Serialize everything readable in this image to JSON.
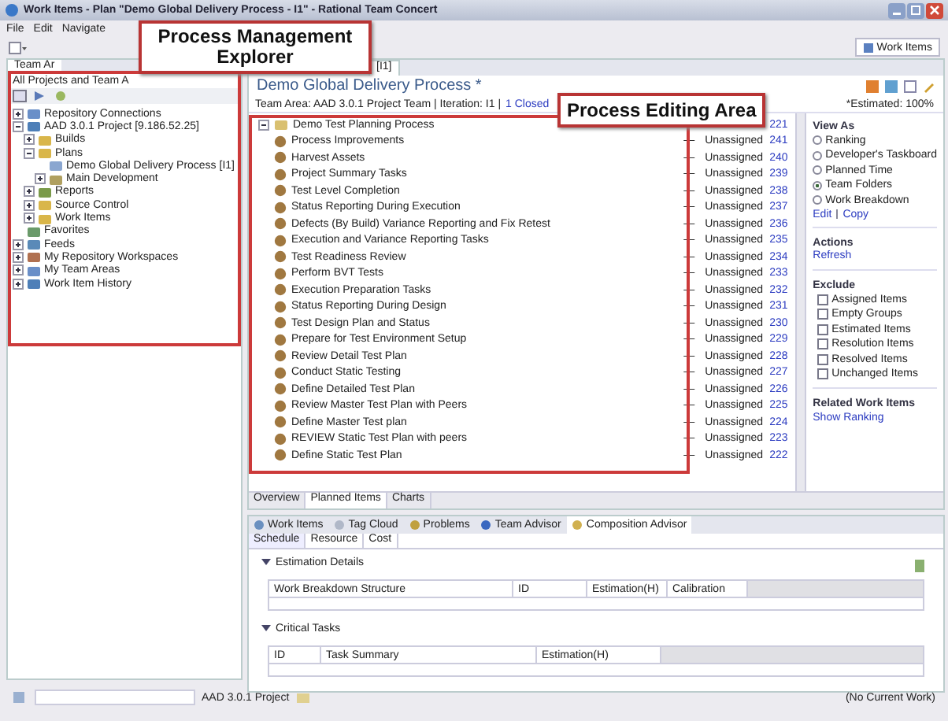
{
  "window": {
    "title": "Work Items - Plan \"Demo Global Delivery Process - I1\" - Rational Team Concert"
  },
  "menu": [
    "File",
    "Edit",
    "Navigate"
  ],
  "perspective": {
    "label": "Work Items"
  },
  "callouts": [
    {
      "text": "Process Management Explorer"
    },
    {
      "text": "Process Editing Area"
    }
  ],
  "explorer": {
    "tab": "Team Ar",
    "filter": "All Projects and Team A",
    "tree": [
      {
        "label": "Repository Connections",
        "expanded": false
      },
      {
        "label": "AAD 3.0.1 Project [9.186.52.25]",
        "expanded": true,
        "children": [
          {
            "label": "Builds",
            "expanded": false
          },
          {
            "label": "Plans",
            "expanded": true,
            "children": [
              {
                "label": "Demo Global Delivery Process [I1]"
              },
              {
                "label": "Main Development",
                "expanded": false
              }
            ]
          },
          {
            "label": "Reports",
            "expanded": false
          },
          {
            "label": "Source Control",
            "expanded": false
          },
          {
            "label": "Work Items",
            "expanded": false
          }
        ]
      },
      {
        "label": "Favorites"
      },
      {
        "label": "Feeds",
        "expanded": false
      },
      {
        "label": "My Repository Workspaces",
        "expanded": false
      },
      {
        "label": "My Team Areas",
        "expanded": false
      },
      {
        "label": "Work Item History",
        "expanded": false
      }
    ]
  },
  "editor": {
    "tab": "[I1]",
    "title": "Demo Global Delivery Process *",
    "team_line": "Team Area: AAD 3.0.1 Project Team | Iteration: I1 |",
    "closed_link": "1 Closed",
    "estimated": "*Estimated: 100%",
    "root": {
      "label": "Demo Test Planning Process",
      "id": "221",
      "expanded": true,
      "children": [
        {
          "label": "Process Improvements",
          "priority": "—",
          "owner": "Unassigned",
          "id": "241"
        },
        {
          "label": "Harvest Assets",
          "priority": "—",
          "owner": "Unassigned",
          "id": "240"
        },
        {
          "label": "Project Summary Tasks",
          "priority": "—",
          "owner": "Unassigned",
          "id": "239"
        },
        {
          "label": "Test Level Completion",
          "priority": "—",
          "owner": "Unassigned",
          "id": "238"
        },
        {
          "label": "Status Reporting During Execution",
          "priority": "—",
          "owner": "Unassigned",
          "id": "237"
        },
        {
          "label": "Defects (By Build) Variance Reporting and Fix Retest",
          "priority": "—",
          "owner": "Unassigned",
          "id": "236"
        },
        {
          "label": "Execution and Variance Reporting Tasks",
          "priority": "—",
          "owner": "Unassigned",
          "id": "235"
        },
        {
          "label": "Test Readiness Review",
          "priority": "—",
          "owner": "Unassigned",
          "id": "234"
        },
        {
          "label": "Perform BVT Tests",
          "priority": "—",
          "owner": "Unassigned",
          "id": "233"
        },
        {
          "label": "Execution Preparation Tasks",
          "priority": "—",
          "owner": "Unassigned",
          "id": "232"
        },
        {
          "label": "Status Reporting During Design",
          "priority": "—",
          "owner": "Unassigned",
          "id": "231"
        },
        {
          "label": "Test Design Plan and Status",
          "priority": "—",
          "owner": "Unassigned",
          "id": "230"
        },
        {
          "label": "Prepare for Test Environment Setup",
          "priority": "—",
          "owner": "Unassigned",
          "id": "229"
        },
        {
          "label": "Review Detail Test Plan",
          "priority": "—",
          "owner": "Unassigned",
          "id": "228"
        },
        {
          "label": "Conduct Static Testing",
          "priority": "—",
          "owner": "Unassigned",
          "id": "227"
        },
        {
          "label": "Define Detailed Test Plan",
          "priority": "—",
          "owner": "Unassigned",
          "id": "226"
        },
        {
          "label": "Review Master Test Plan with Peers",
          "priority": "—",
          "owner": "Unassigned",
          "id": "225"
        },
        {
          "label": "Define Master Test plan",
          "priority": "—",
          "owner": "Unassigned",
          "id": "224"
        },
        {
          "label": "REVIEW Static Test Plan with peers",
          "priority": "—",
          "owner": "Unassigned",
          "id": "223"
        },
        {
          "label": "Define Static Test Plan",
          "priority": "—",
          "owner": "Unassigned",
          "id": "222"
        }
      ]
    },
    "side": {
      "view_title": "View As",
      "views": [
        {
          "label": "Ranking",
          "selected": false
        },
        {
          "label": "Developer's Taskboard",
          "selected": false
        },
        {
          "label": "Planned Time",
          "selected": false
        },
        {
          "label": "Team Folders",
          "selected": true
        },
        {
          "label": "Work Breakdown",
          "selected": false
        }
      ],
      "edit_links": [
        "Edit",
        "Copy"
      ],
      "actions_title": "Actions",
      "actions": [
        "Refresh"
      ],
      "exclude_title": "Exclude",
      "excludes": [
        {
          "label": "Assigned Items",
          "checked": false
        },
        {
          "label": "Empty Groups",
          "checked": false
        },
        {
          "label": "Estimated Items",
          "checked": false
        },
        {
          "label": "Resolution Items",
          "checked": false
        },
        {
          "label": "Resolved Items",
          "checked": false
        },
        {
          "label": "Unchanged Items",
          "checked": false
        }
      ],
      "related_title": "Related Work Items",
      "related_link": "Show Ranking"
    },
    "page_tabs": [
      {
        "label": "Overview",
        "selected": false
      },
      {
        "label": "Planned Items",
        "selected": true
      },
      {
        "label": "Charts",
        "selected": false
      }
    ]
  },
  "bottom": {
    "views": [
      {
        "label": "Work Items",
        "selected": false
      },
      {
        "label": "Tag Cloud",
        "selected": false
      },
      {
        "label": "Problems",
        "selected": false
      },
      {
        "label": "Team Advisor",
        "selected": false
      },
      {
        "label": "Composition Advisor",
        "selected": true
      }
    ],
    "subtabs": [
      {
        "label": "Schedule",
        "selected": true
      },
      {
        "label": "Resource",
        "selected": false
      },
      {
        "label": "Cost",
        "selected": false
      }
    ],
    "sections": [
      {
        "title": "Estimation Details",
        "expanded": true,
        "columns": [
          "Work Breakdown Structure",
          "ID",
          "Estimation(H)",
          "Calibration"
        ]
      },
      {
        "title": "Critical Tasks",
        "expanded": true,
        "columns": [
          "ID",
          "Task Summary",
          "Estimation(H)"
        ]
      }
    ]
  },
  "status": {
    "project": "AAD 3.0.1 Project",
    "work": "(No Current Work)"
  }
}
